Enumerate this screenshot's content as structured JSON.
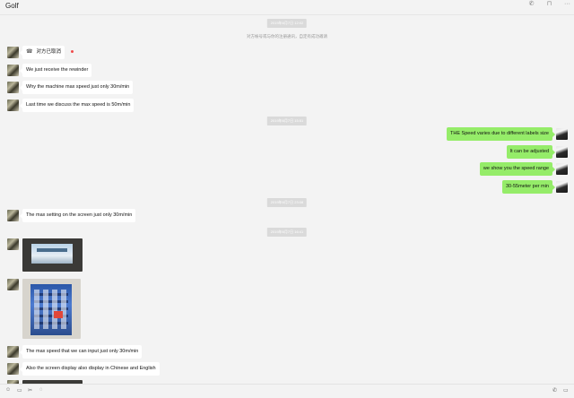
{
  "header": {
    "title": "Golf",
    "icons": [
      "phone-icon",
      "pin-icon",
      "more-icon"
    ],
    "phone_glyph": "✆",
    "pin_glyph": "⊓",
    "more_glyph": "···"
  },
  "messages": {
    "ts1": "2019年6月7日 12:02",
    "system": "对方帐号或与你的注册通讯，自定有成功邀请",
    "call_status": "对方已取消",
    "m1": "We just receive the rewinder",
    "m2": "Why the machine max speed just only 30m/min",
    "m3": "Last time we discuss the max speed is 50m/min",
    "ts2": "2019年6月7日 15:51",
    "r1": "THE Speed varies due to different labels size",
    "r2": "It can be adjusted",
    "r3": "we show you the speed range",
    "r4": "30-55meter per min",
    "ts3": "2019年6月7日 23:08",
    "m4": "The max setting on the screen just only 30m/min",
    "ts4": "2019年6月7日 16:41",
    "m5": "The max speed that we can input just only 30m/min",
    "m6": "Also the screen display also display in  Chinese and English"
  },
  "toolbar": {
    "emoji_glyph": "☺",
    "folder_glyph": "▭",
    "scissors_glyph": "✂",
    "chat_glyph": "◌",
    "call_glyph": "✆",
    "video_glyph": "▭"
  },
  "colors": {
    "background": "#f3f3f3",
    "my_bubble": "#95ec69",
    "their_bubble": "#ffffff",
    "unread_dot": "#f04a4a"
  }
}
